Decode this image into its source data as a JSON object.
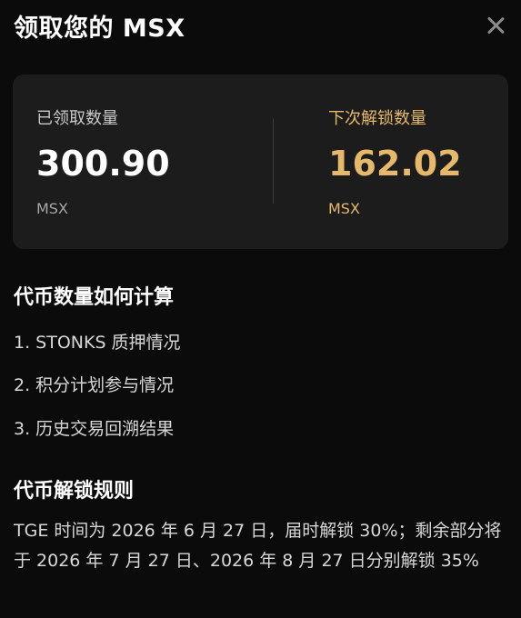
{
  "header": {
    "title": "领取您的 MSX"
  },
  "stats": {
    "claimed": {
      "label": "已领取数量",
      "value": "300.90",
      "unit": "MSX"
    },
    "next_unlock": {
      "label": "下次解锁数量",
      "value": "162.02",
      "unit": "MSX"
    }
  },
  "calculation": {
    "title": "代币数量如何计算",
    "items": [
      "1. STONKS 质押情况",
      "2. 积分计划参与情况",
      "3. 历史交易回溯结果"
    ]
  },
  "rules": {
    "title": "代币解锁规则",
    "text": "TGE 时间为 2026 年 6 月 27 日，届时解锁 30%；剩余部分将于 2026 年 7 月 27 日、2026 年 8 月 27 日分别解锁 35%"
  },
  "colors": {
    "background": "#0b0b0b",
    "card": "#1c1c1c",
    "accent": "#e6b86a",
    "close_icon": "#8a8a8a"
  }
}
